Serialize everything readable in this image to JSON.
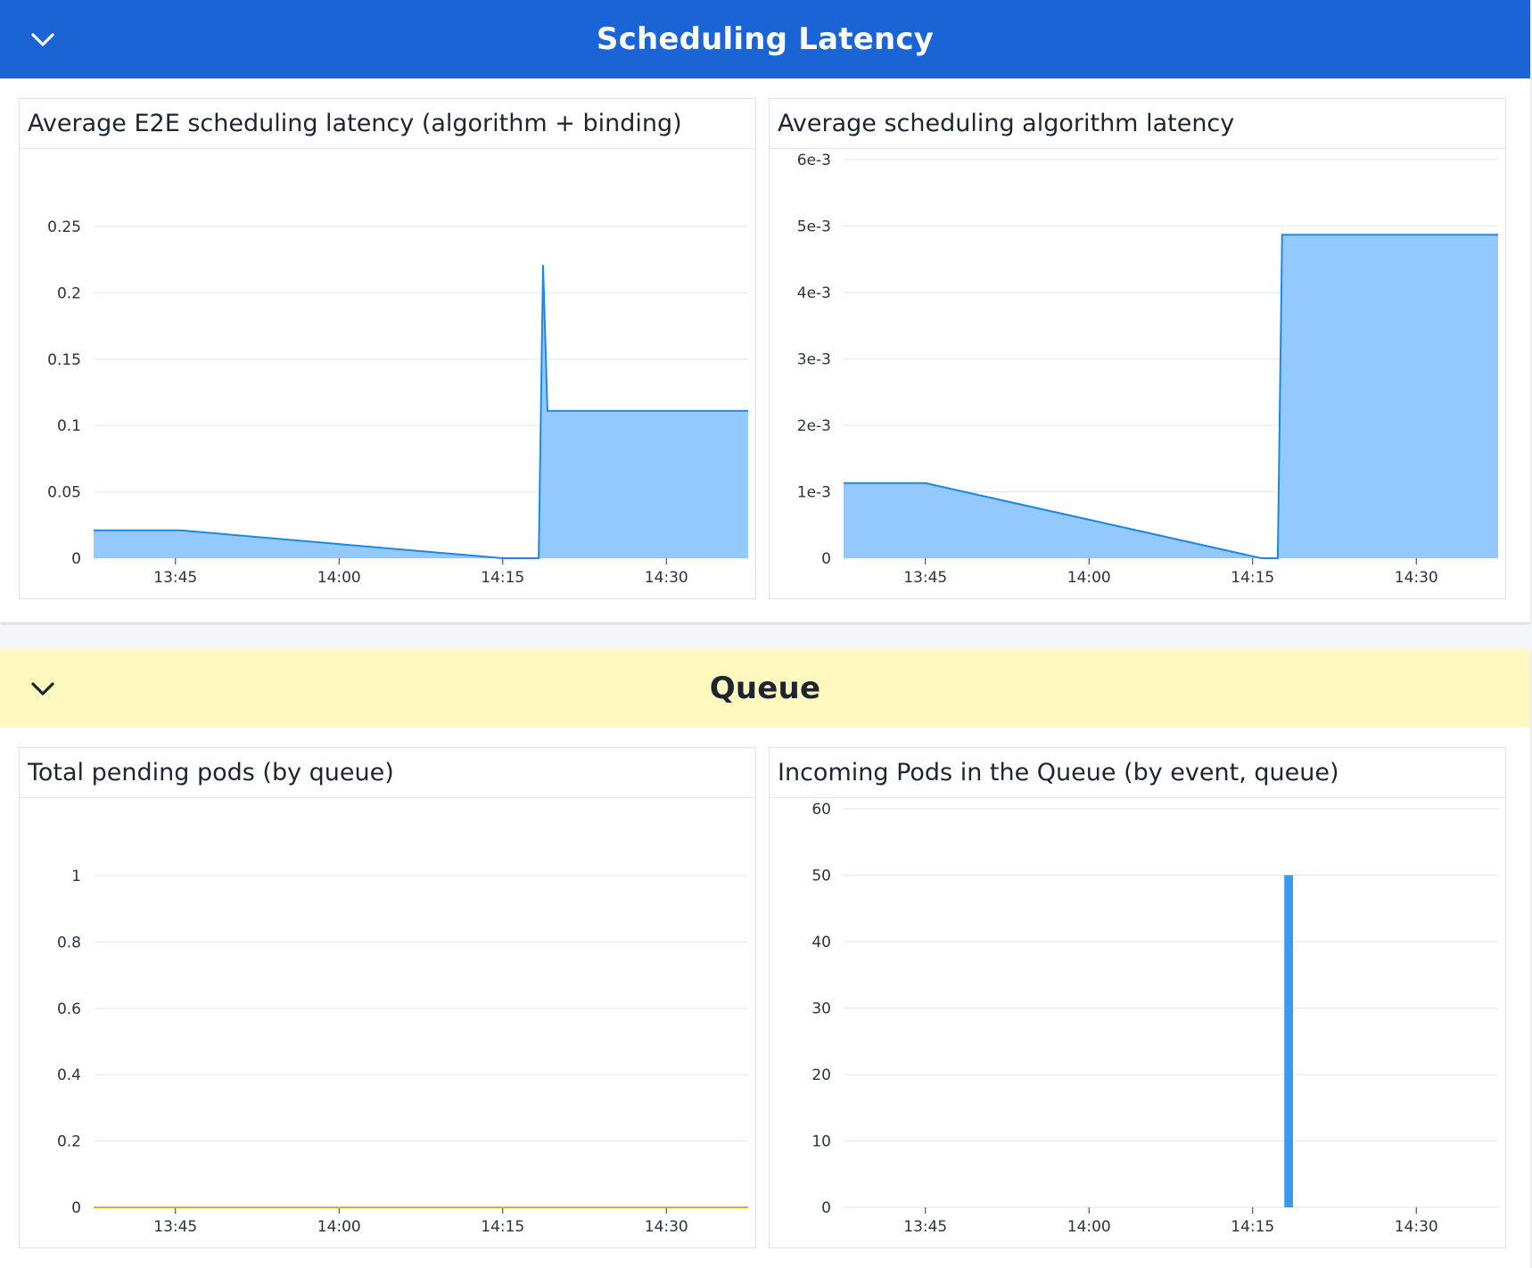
{
  "sections": [
    {
      "title": "Scheduling Latency",
      "collapse_icon": "chevron-down-icon",
      "header_color": "#1a64d6",
      "title_color": "#ffffff",
      "panels": [
        {
          "title": "Average E2E scheduling latency (algorithm + binding)",
          "chart_data": {
            "type": "area",
            "x_ticks": [
              "13:45",
              "14:00",
              "14:15",
              "14:30"
            ],
            "x_tick_minutes": [
              825,
              840,
              855,
              870
            ],
            "xlim_minutes": [
              817.5,
              877.5
            ],
            "y_ticks": [
              "0",
              "0.05",
              "0.1",
              "0.15",
              "0.2",
              "0.25"
            ],
            "y_tick_values": [
              0,
              0.05,
              0.1,
              0.15,
              0.2,
              0.25
            ],
            "ylim": [
              0,
              0.25
            ],
            "grid": true,
            "series": [
              {
                "color": "#1e88e5",
                "fill": "#93c9fc",
                "points": [
                  [
                    817.5,
                    0.021
                  ],
                  [
                    825.5,
                    0.021
                  ],
                  [
                    855.0,
                    0.0
                  ],
                  [
                    858.3,
                    0.0
                  ],
                  [
                    858.7,
                    0.221
                  ],
                  [
                    859.1,
                    0.111
                  ],
                  [
                    877.5,
                    0.111
                  ]
                ]
              }
            ]
          }
        },
        {
          "title": "Average scheduling algorithm latency",
          "chart_data": {
            "type": "area",
            "x_ticks": [
              "13:45",
              "14:00",
              "14:15",
              "14:30"
            ],
            "x_tick_minutes": [
              825,
              840,
              855,
              870
            ],
            "xlim_minutes": [
              817.5,
              877.5
            ],
            "y_ticks": [
              "0",
              "1e-3",
              "2e-3",
              "3e-3",
              "4e-3",
              "5e-3",
              "6e-3"
            ],
            "y_tick_values": [
              0,
              0.001,
              0.002,
              0.003,
              0.004,
              0.005,
              0.006
            ],
            "ylim": [
              0,
              0.006
            ],
            "grid": true,
            "series": [
              {
                "color": "#1e88e5",
                "fill": "#93c9fc",
                "points": [
                  [
                    817.5,
                    0.00113
                  ],
                  [
                    825.0,
                    0.00113
                  ],
                  [
                    855.8,
                    0.0
                  ],
                  [
                    857.3,
                    0.0
                  ],
                  [
                    857.7,
                    0.00487
                  ],
                  [
                    877.5,
                    0.00487
                  ]
                ]
              }
            ]
          }
        }
      ]
    },
    {
      "title": "Queue",
      "collapse_icon": "chevron-down-icon",
      "header_color": "#fff9c0",
      "title_color": "#1d2530",
      "panels": [
        {
          "title": "Total pending pods (by queue)",
          "chart_data": {
            "type": "line",
            "x_ticks": [
              "13:45",
              "14:00",
              "14:15",
              "14:30"
            ],
            "x_tick_minutes": [
              825,
              840,
              855,
              870
            ],
            "xlim_minutes": [
              817.5,
              877.5
            ],
            "y_ticks": [
              "0",
              "0.2",
              "0.4",
              "0.6",
              "0.8",
              "1"
            ],
            "y_tick_values": [
              0,
              0.2,
              0.4,
              0.6,
              0.8,
              1
            ],
            "ylim": [
              0,
              1
            ],
            "grid": true,
            "series": [
              {
                "color": "#d8b126",
                "points": [
                  [
                    817.5,
                    0
                  ],
                  [
                    877.5,
                    0
                  ]
                ]
              }
            ]
          }
        },
        {
          "title": "Incoming Pods in the Queue (by event, queue)",
          "chart_data": {
            "type": "bar",
            "x_ticks": [
              "13:45",
              "14:00",
              "14:15",
              "14:30"
            ],
            "x_tick_minutes": [
              825,
              840,
              855,
              870
            ],
            "xlim_minutes": [
              817.5,
              877.5
            ],
            "y_ticks": [
              "0",
              "10",
              "20",
              "30",
              "40",
              "50",
              "60"
            ],
            "y_tick_values": [
              0,
              10,
              20,
              30,
              40,
              50,
              60
            ],
            "ylim": [
              0,
              60
            ],
            "grid": true,
            "series": [
              {
                "color": "#3a9aee",
                "bars": [
                  [
                    858.3,
                    50
                  ]
                ],
                "bar_width_minutes": 0.8
              }
            ]
          }
        }
      ]
    }
  ]
}
